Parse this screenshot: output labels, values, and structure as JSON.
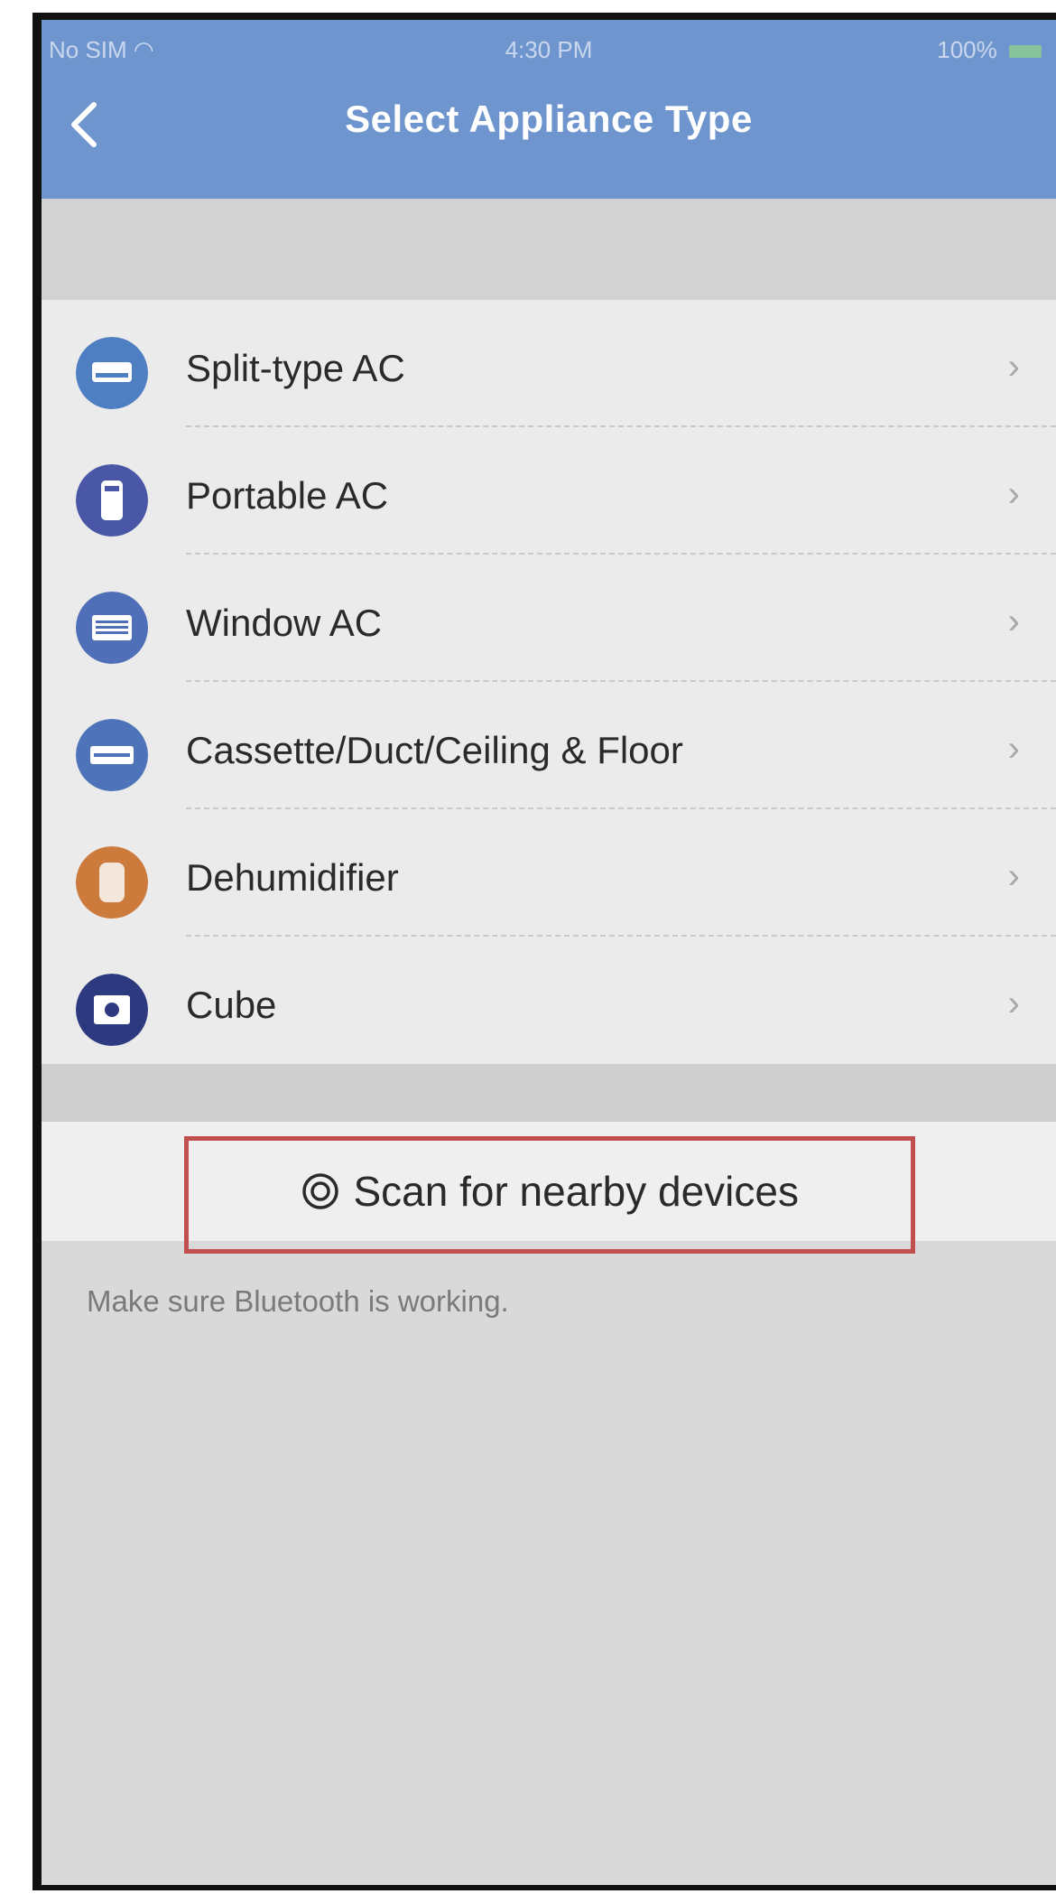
{
  "status_bar": {
    "carrier": "No SIM",
    "time": "4:30 PM",
    "battery": "100%"
  },
  "nav": {
    "title": "Select Appliance Type",
    "back_icon": "chevron-left-icon"
  },
  "appliances": [
    {
      "label": "Split-type AC",
      "icon": "split-ac-icon",
      "color": "#4f7fc3"
    },
    {
      "label": "Portable AC",
      "icon": "portable-ac-icon",
      "color": "#4a56a6"
    },
    {
      "label": "Window AC",
      "icon": "window-ac-icon",
      "color": "#4f6fb8"
    },
    {
      "label": "Cassette/Duct/Ceiling & Floor",
      "icon": "cassette-ac-icon",
      "color": "#4f73b8"
    },
    {
      "label": "Dehumidifier",
      "icon": "dehumidifier-icon",
      "color": "#cc7b3d"
    },
    {
      "label": "Cube",
      "icon": "cube-icon",
      "color": "#2e3a80"
    }
  ],
  "scan": {
    "label": "Scan for nearby devices",
    "icon": "scan-icon",
    "highlight_color": "#c0504d"
  },
  "hint": "Make sure Bluetooth is working."
}
